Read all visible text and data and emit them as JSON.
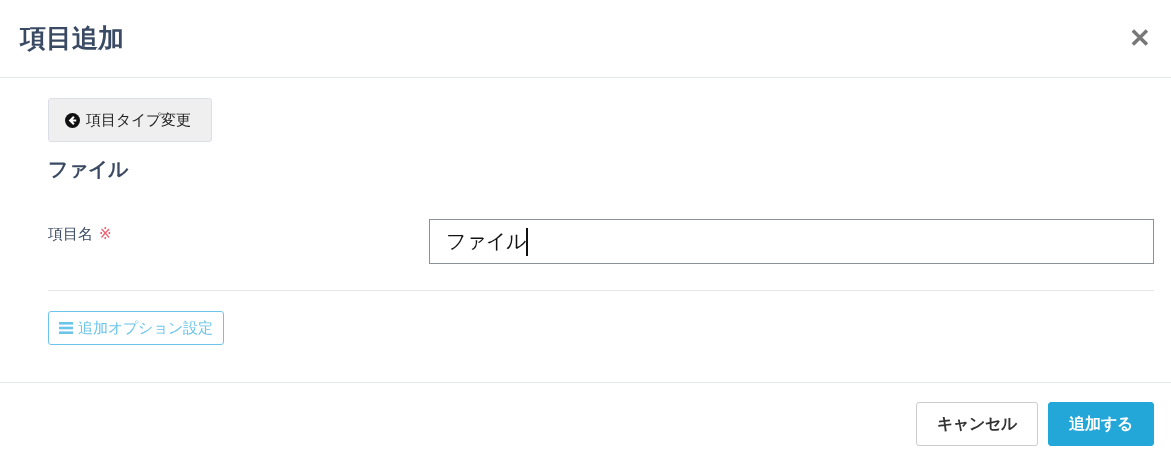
{
  "dialog": {
    "title": "項目追加",
    "close": "✕"
  },
  "back_button": {
    "label": "項目タイプ変更"
  },
  "item_type": "ファイル",
  "fields": [
    {
      "label": "項目名",
      "required_mark": "※",
      "value": "ファイル",
      "focused": true
    }
  ],
  "options_button": {
    "label": "追加オプション設定"
  },
  "buttons": [
    {
      "label": "キャンセル",
      "kind": "secondary"
    },
    {
      "label": "追加する",
      "kind": "primary"
    }
  ]
}
